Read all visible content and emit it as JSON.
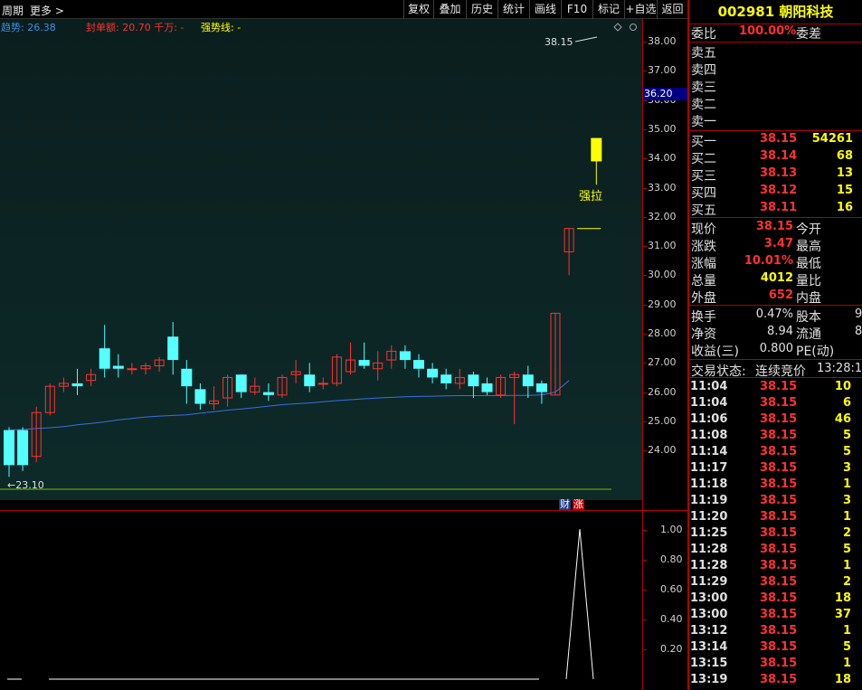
{
  "toolbar": {
    "period": "周期",
    "more": "更多",
    "buttons": [
      "复权",
      "叠加",
      "历史",
      "统计",
      "画线",
      "F10",
      "标记",
      "+自选",
      "返回"
    ]
  },
  "indicators": {
    "trend": "趋势: 26.38",
    "seal": "封单额: 20.70 千万: -",
    "strong": "强势线: -"
  },
  "chart_data": {
    "type": "candlestick",
    "y_ticks": [
      "38.00",
      "37.00",
      "36.00",
      "35.00",
      "34.00",
      "33.00",
      "32.00",
      "31.00",
      "30.00",
      "29.00",
      "28.00",
      "27.00",
      "26.00",
      "25.00",
      "24.00"
    ],
    "y_range": [
      23.0,
      38.6
    ],
    "price_tag": "36.20",
    "high_label": "38.15",
    "low_label": "23.10",
    "annotation": "强拉",
    "candles": [
      {
        "o": 24.7,
        "c": 23.5,
        "h": 24.8,
        "l": 23.1
      },
      {
        "o": 24.7,
        "c": 23.5,
        "h": 24.8,
        "l": 23.3
      },
      {
        "o": 23.8,
        "c": 25.3,
        "h": 25.5,
        "l": 23.6
      },
      {
        "o": 25.3,
        "c": 26.2,
        "h": 26.3,
        "l": 25.2
      },
      {
        "o": 26.2,
        "c": 26.3,
        "h": 26.5,
        "l": 26.0
      },
      {
        "o": 26.3,
        "c": 26.2,
        "h": 26.8,
        "l": 25.9
      },
      {
        "o": 26.4,
        "c": 26.6,
        "h": 26.8,
        "l": 26.2
      },
      {
        "o": 27.5,
        "c": 26.8,
        "h": 28.3,
        "l": 26.5
      },
      {
        "o": 26.9,
        "c": 26.8,
        "h": 27.3,
        "l": 26.5
      },
      {
        "o": 26.8,
        "c": 26.8,
        "h": 27.0,
        "l": 26.6
      },
      {
        "o": 26.8,
        "c": 26.9,
        "h": 27.0,
        "l": 26.6
      },
      {
        "o": 26.9,
        "c": 27.1,
        "h": 27.2,
        "l": 26.7
      },
      {
        "o": 27.9,
        "c": 27.1,
        "h": 28.4,
        "l": 26.6
      },
      {
        "o": 26.8,
        "c": 26.2,
        "h": 27.1,
        "l": 25.6
      },
      {
        "o": 26.1,
        "c": 25.6,
        "h": 26.3,
        "l": 25.4
      },
      {
        "o": 25.6,
        "c": 25.7,
        "h": 26.2,
        "l": 25.4
      },
      {
        "o": 25.8,
        "c": 26.5,
        "h": 26.6,
        "l": 25.5
      },
      {
        "o": 26.6,
        "c": 26.0,
        "h": 26.6,
        "l": 25.8
      },
      {
        "o": 26.0,
        "c": 26.2,
        "h": 26.5,
        "l": 25.9
      },
      {
        "o": 26.0,
        "c": 25.9,
        "h": 26.3,
        "l": 25.7
      },
      {
        "o": 25.9,
        "c": 26.5,
        "h": 26.6,
        "l": 25.8
      },
      {
        "o": 26.6,
        "c": 26.7,
        "h": 27.1,
        "l": 26.3
      },
      {
        "o": 26.6,
        "c": 26.2,
        "h": 27.0,
        "l": 26.0
      },
      {
        "o": 26.3,
        "c": 26.3,
        "h": 26.5,
        "l": 26.1
      },
      {
        "o": 26.3,
        "c": 27.2,
        "h": 27.3,
        "l": 26.2
      },
      {
        "o": 26.7,
        "c": 27.1,
        "h": 27.7,
        "l": 26.6
      },
      {
        "o": 27.1,
        "c": 26.9,
        "h": 27.7,
        "l": 26.8
      },
      {
        "o": 26.8,
        "c": 27.0,
        "h": 27.4,
        "l": 26.4
      },
      {
        "o": 27.1,
        "c": 27.4,
        "h": 27.6,
        "l": 26.8
      },
      {
        "o": 27.4,
        "c": 27.1,
        "h": 27.6,
        "l": 26.8
      },
      {
        "o": 27.1,
        "c": 26.8,
        "h": 27.3,
        "l": 26.5
      },
      {
        "o": 26.8,
        "c": 26.5,
        "h": 27.0,
        "l": 26.3
      },
      {
        "o": 26.6,
        "c": 26.3,
        "h": 26.8,
        "l": 26.1
      },
      {
        "o": 26.3,
        "c": 26.5,
        "h": 26.8,
        "l": 26.1
      },
      {
        "o": 26.6,
        "c": 26.2,
        "h": 26.7,
        "l": 25.8
      },
      {
        "o": 26.3,
        "c": 26.0,
        "h": 26.5,
        "l": 25.9
      },
      {
        "o": 25.9,
        "c": 26.5,
        "h": 26.6,
        "l": 25.8
      },
      {
        "o": 26.5,
        "c": 26.6,
        "h": 26.7,
        "l": 24.9
      },
      {
        "o": 26.6,
        "c": 26.2,
        "h": 26.9,
        "l": 25.8
      },
      {
        "o": 26.3,
        "c": 26.0,
        "h": 26.4,
        "l": 25.6
      },
      {
        "o": 25.9,
        "c": 28.7,
        "h": 28.7,
        "l": 25.9
      },
      {
        "o": 30.8,
        "c": 31.6,
        "h": 31.6,
        "l": 30.0
      },
      {
        "o": 31.6,
        "c": 31.6,
        "h": 31.6,
        "l": 31.6
      },
      {
        "o": 34.7,
        "c": 33.9,
        "h": 34.7,
        "l": 33.1
      }
    ],
    "ma": [
      24.7,
      24.72,
      24.76,
      24.78,
      24.82,
      24.88,
      24.93,
      24.98,
      25.05,
      25.1,
      25.15,
      25.18,
      25.2,
      25.22,
      25.28,
      25.33,
      25.38,
      25.42,
      25.47,
      25.52,
      25.57,
      25.6,
      25.63,
      25.67,
      25.71,
      25.74,
      25.77,
      25.8,
      25.82,
      25.84,
      25.85,
      25.86,
      25.87,
      25.88,
      25.88,
      25.88,
      25.88,
      25.89,
      25.89,
      25.9,
      26.0,
      26.4
    ],
    "sub_y_ticks": [
      "1.00",
      "0.80",
      "0.60",
      "0.40",
      "0.20"
    ],
    "sub_spike": 1.0
  },
  "quote": {
    "code": "002981",
    "name": "朝阳科技",
    "weibi": {
      "label": "委比",
      "value": "100.00%",
      "label2": "委差"
    },
    "asks": [
      {
        "l": "卖五"
      },
      {
        "l": "卖四"
      },
      {
        "l": "卖三"
      },
      {
        "l": "卖二"
      },
      {
        "l": "卖一"
      }
    ],
    "bids": [
      {
        "l": "买一",
        "p": "38.15",
        "v": "54261"
      },
      {
        "l": "买二",
        "p": "38.14",
        "v": "68"
      },
      {
        "l": "买三",
        "p": "38.13",
        "v": "13"
      },
      {
        "l": "买四",
        "p": "38.12",
        "v": "15"
      },
      {
        "l": "买五",
        "p": "38.11",
        "v": "16"
      }
    ],
    "stats": [
      {
        "l": "现价",
        "v": "38.15",
        "r": "今开"
      },
      {
        "l": "涨跌",
        "v": "3.47",
        "r": "最高"
      },
      {
        "l": "涨幅",
        "v": "10.01%",
        "r": "最低"
      },
      {
        "l": "总量",
        "v": "4012",
        "r": "量比"
      },
      {
        "l": "外盘",
        "v": "652",
        "r": "内盘"
      }
    ],
    "fin": [
      {
        "l": "换手",
        "v": "0.47%",
        "r": "股本",
        "x": "9"
      },
      {
        "l": "净资",
        "v": "8.94",
        "r": "流通",
        "x": "8"
      },
      {
        "l": "收益(三)",
        "v": "0.800",
        "r": "PE(动)",
        "x": ""
      }
    ],
    "status": {
      "label": "交易状态:",
      "value": "连续竞价",
      "time": "13:28:1"
    },
    "ticks": [
      {
        "t": "11:04",
        "p": "38.15",
        "v": "10"
      },
      {
        "t": "11:04",
        "p": "38.15",
        "v": "6"
      },
      {
        "t": "11:06",
        "p": "38.15",
        "v": "46"
      },
      {
        "t": "11:08",
        "p": "38.15",
        "v": "5"
      },
      {
        "t": "11:14",
        "p": "38.15",
        "v": "5"
      },
      {
        "t": "11:17",
        "p": "38.15",
        "v": "3"
      },
      {
        "t": "11:18",
        "p": "38.15",
        "v": "1"
      },
      {
        "t": "11:19",
        "p": "38.15",
        "v": "3"
      },
      {
        "t": "11:20",
        "p": "38.15",
        "v": "1"
      },
      {
        "t": "11:25",
        "p": "38.15",
        "v": "2"
      },
      {
        "t": "11:28",
        "p": "38.15",
        "v": "5"
      },
      {
        "t": "11:28",
        "p": "38.15",
        "v": "1"
      },
      {
        "t": "11:29",
        "p": "38.15",
        "v": "2"
      },
      {
        "t": "13:00",
        "p": "38.15",
        "v": "18"
      },
      {
        "t": "13:00",
        "p": "38.15",
        "v": "37"
      },
      {
        "t": "13:12",
        "p": "38.15",
        "v": "1"
      },
      {
        "t": "13:14",
        "p": "38.15",
        "v": "5"
      },
      {
        "t": "13:15",
        "p": "38.15",
        "v": "1"
      },
      {
        "t": "13:19",
        "p": "38.15",
        "v": "18"
      }
    ]
  },
  "badges": {
    "cai": "财",
    "zhang": "涨"
  },
  "colors": {
    "up": "#ff3232",
    "down": "#54ffff",
    "ma": "#3a6fe0",
    "support": "#6ec000",
    "yellow": "#ffff00",
    "red": "#ff3232"
  }
}
